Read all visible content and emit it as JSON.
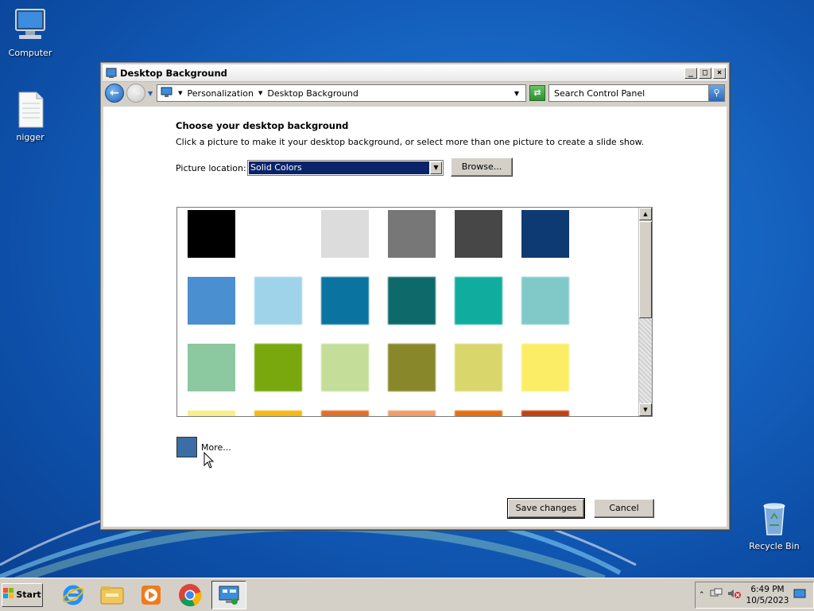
{
  "desktop": {
    "icons": [
      {
        "label": "Computer"
      },
      {
        "label": "nigger"
      },
      {
        "label": "Recycle Bin"
      }
    ]
  },
  "window": {
    "title": "Desktop Background",
    "controls": {
      "minimize": "_",
      "maximize": "□",
      "close": "×"
    },
    "breadcrumb": [
      "Personalization",
      "Desktop Background"
    ],
    "search_placeholder": "Search Control Panel"
  },
  "main": {
    "heading": "Choose your desktop background",
    "instructions": "Click a picture to make it your desktop background, or select more than one picture to create a slide show.",
    "picture_location_label": "Picture location:",
    "picture_location_value": "Solid Colors",
    "browse_label": "Browse...",
    "more_label": "More...",
    "more_color": "#3a6ea5",
    "swatches": [
      "#000000",
      "#ffffff",
      "#dcdcdc",
      "#777777",
      "#474747",
      "#0e3a73",
      "#4a8fd0",
      "#9fd3ea",
      "#0b73a0",
      "#0e6a6a",
      "#10ad9f",
      "#80c9c8",
      "#8cc9a0",
      "#78a70e",
      "#c4dd98",
      "#88882a",
      "#d9d76c",
      "#fbee66",
      "#f9ef8a",
      "#f4b916",
      "#e0702a",
      "#f09e6a",
      "#e56f10",
      "#c0420f"
    ],
    "save_label": "Save changes",
    "cancel_label": "Cancel"
  },
  "taskbar": {
    "start_label": "Start",
    "apps": [
      "internet-explorer",
      "file-explorer",
      "media-player",
      "chrome",
      "control-panel"
    ],
    "clock_time": "6:49 PM",
    "clock_date": "10/5/2023"
  }
}
